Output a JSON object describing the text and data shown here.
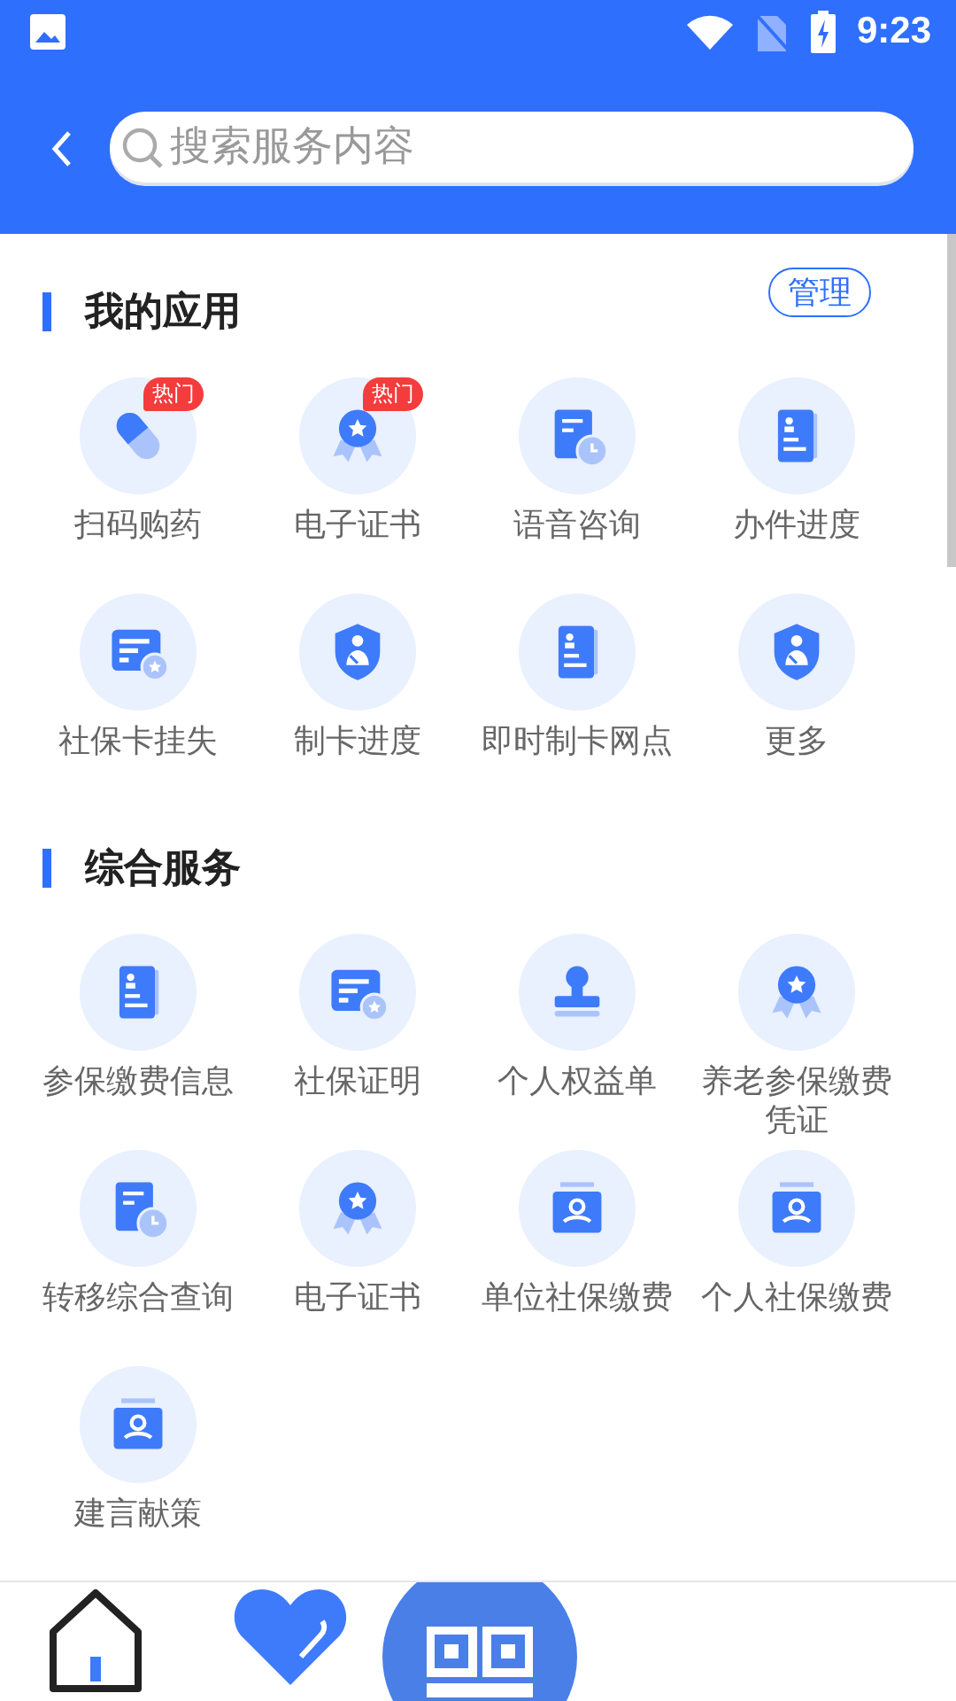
{
  "status_bar": {
    "time": "9:23"
  },
  "search": {
    "placeholder": "搜索服务内容"
  },
  "sections": [
    {
      "title": "我的应用",
      "action": "管理",
      "items": [
        {
          "label": "扫码购药",
          "badge": "热门"
        },
        {
          "label": "电子证书",
          "badge": "热门"
        },
        {
          "label": "语音咨询"
        },
        {
          "label": "办件进度"
        },
        {
          "label": "社保卡挂失"
        },
        {
          "label": "制卡进度"
        },
        {
          "label": "即时制卡网点"
        },
        {
          "label": "更多"
        }
      ]
    },
    {
      "title": "综合服务",
      "items": [
        {
          "label": "参保缴费信息"
        },
        {
          "label": "社保证明"
        },
        {
          "label": "个人权益单"
        },
        {
          "label": "养老参保缴费凭证"
        },
        {
          "label": "转移综合查询"
        },
        {
          "label": "电子证书"
        },
        {
          "label": "单位社保缴费"
        },
        {
          "label": "个人社保缴费"
        },
        {
          "label": "建言献策"
        }
      ]
    }
  ]
}
